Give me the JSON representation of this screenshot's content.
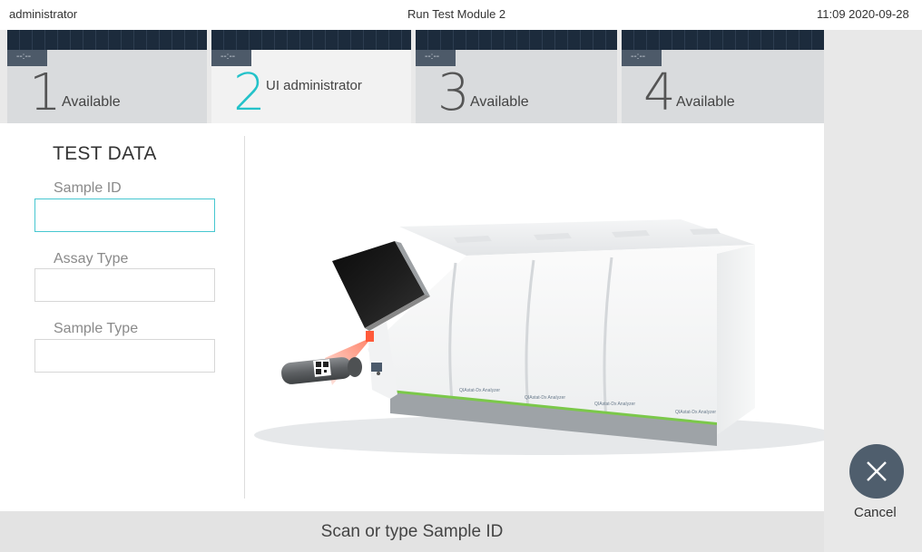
{
  "topbar": {
    "user": "administrator",
    "title": "Run Test Module 2",
    "datetime": "11:09 2020-09-28"
  },
  "modules": [
    {
      "number": "1",
      "status": "Available",
      "chip": "--:--"
    },
    {
      "number": "2",
      "status": "UI administrator",
      "chip": "--:--"
    },
    {
      "number": "3",
      "status": "Available",
      "chip": "--:--"
    },
    {
      "number": "4",
      "status": "Available",
      "chip": "--:--"
    }
  ],
  "test_data": {
    "title": "TEST DATA",
    "sample_id": {
      "label": "Sample ID",
      "value": ""
    },
    "assay_type": {
      "label": "Assay Type",
      "value": ""
    },
    "sample_type": {
      "label": "Sample Type",
      "value": ""
    }
  },
  "prompt": "Scan or type Sample ID",
  "cancel": {
    "label": "Cancel"
  },
  "colors": {
    "accent": "#23c2c9",
    "header_dark": "#1c2b3c",
    "button": "#4f5e6d"
  },
  "illustration": {
    "description_icon": "analyzer-instrument-icon",
    "unit_labels": [
      "QIAstat-Dx Analyzer",
      "QIAstat-Dx Analyzer",
      "QIAstat-Dx Analyzer",
      "QIAstat-Dx Analyzer"
    ]
  }
}
